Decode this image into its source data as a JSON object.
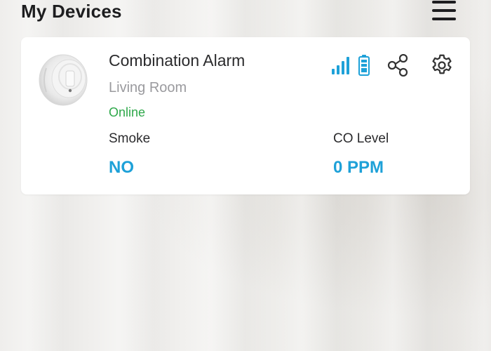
{
  "header": {
    "title": "My Devices",
    "menu_icon": "hamburger-menu-icon"
  },
  "device": {
    "name": "Combination Alarm",
    "room": "Living Room",
    "status": "Online",
    "signal_icon": "signal-bars-icon",
    "battery_icon": "battery-full-icon",
    "share_icon": "share-icon",
    "settings_icon": "gear-icon",
    "metrics": [
      {
        "label": "Smoke",
        "value": "NO"
      },
      {
        "label": "CO Level",
        "value": "0 PPM"
      }
    ]
  },
  "colors": {
    "accent": "#1ea1d8",
    "online": "#2ea84a",
    "text_primary": "#2b2b2d",
    "text_secondary": "#9a9a9e"
  }
}
